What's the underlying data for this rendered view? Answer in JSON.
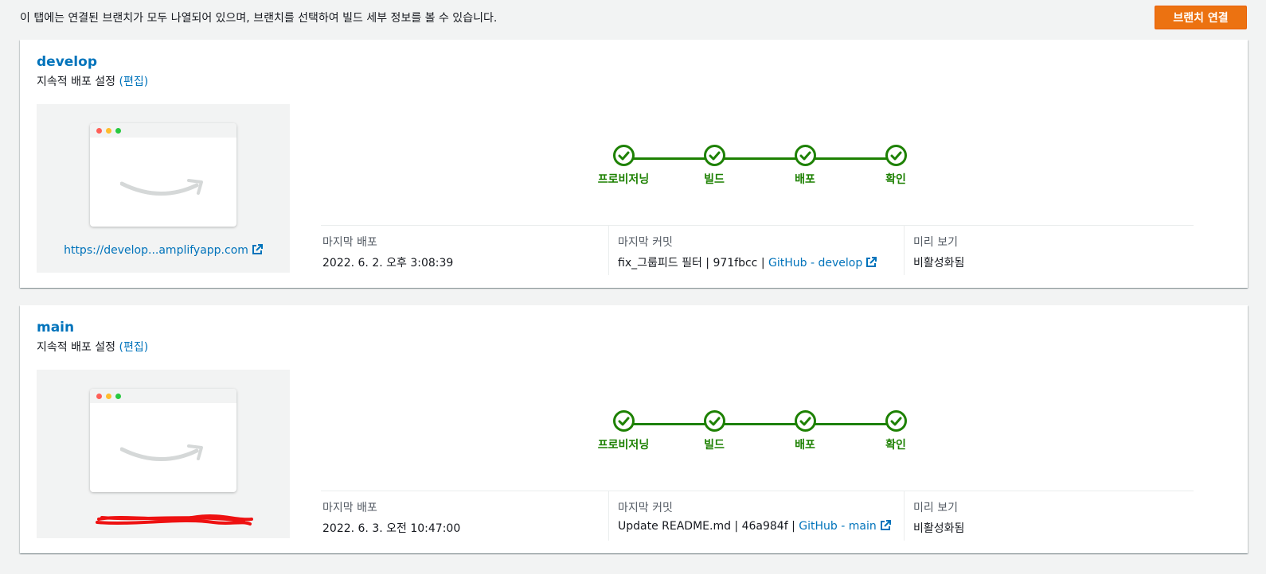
{
  "header": {
    "intro_text": "이 탭에는 연결된 브랜치가 모두 나열되어 있으며, 브랜치를 선택하여 빌드 세부 정보를 볼 수 있습니다.",
    "connect_button_label": "브랜치 연결"
  },
  "colors": {
    "accent_orange": "#ec7211",
    "link_blue": "#0073bb",
    "success_green": "#1d8102"
  },
  "branches": [
    {
      "name": "develop",
      "cd_label": "지속적 배포 설정",
      "edit_label": "(편집)",
      "domain_link": "https://develop...amplifyapp.com",
      "domain_redacted": false,
      "stages": [
        "프로비저닝",
        "빌드",
        "배포",
        "확인"
      ],
      "last_deploy": {
        "label": "마지막 배포",
        "value": "2022. 6. 2. 오후 3:08:39"
      },
      "last_commit": {
        "label": "마지막 커밋",
        "text": "fix_그룹피드 필터 | 971fbcc |",
        "link": "GitHub - develop"
      },
      "preview": {
        "label": "미리 보기",
        "value": "비활성화됨"
      }
    },
    {
      "name": "main",
      "cd_label": "지속적 배포 설정",
      "edit_label": "(편집)",
      "domain_link": "",
      "domain_redacted": true,
      "stages": [
        "프로비저닝",
        "빌드",
        "배포",
        "확인"
      ],
      "last_deploy": {
        "label": "마지막 배포",
        "value": "2022. 6. 3. 오전 10:47:00"
      },
      "last_commit": {
        "label": "마지막 커밋",
        "text": "Update README.md | 46a984f |",
        "link": "GitHub - main"
      },
      "preview": {
        "label": "미리 보기",
        "value": "비활성화됨"
      }
    }
  ]
}
